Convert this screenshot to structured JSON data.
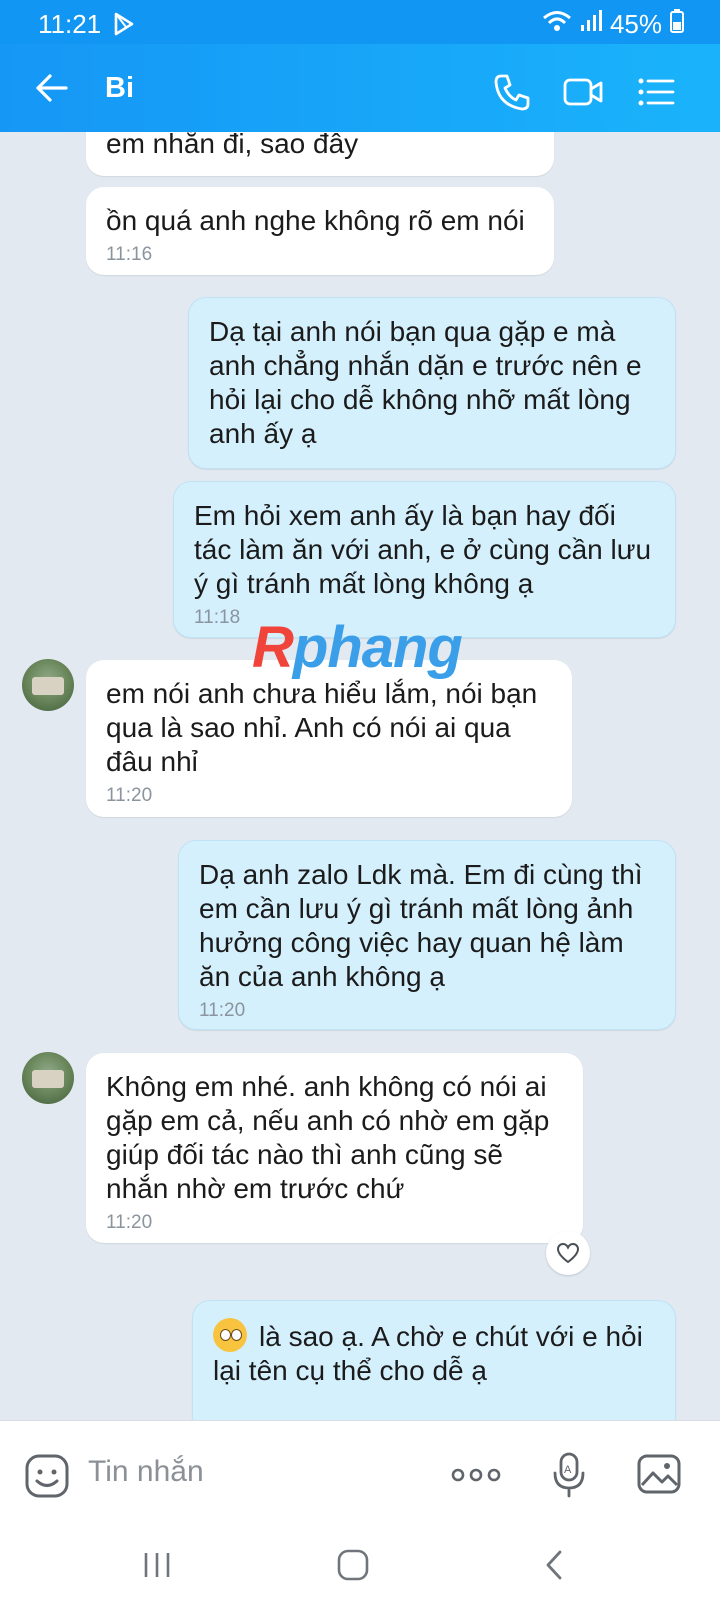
{
  "status_bar": {
    "time": "11:21",
    "battery": "45%",
    "icons": [
      "play-store-icon",
      "wifi-icon",
      "signal-icon",
      "battery-icon"
    ]
  },
  "header": {
    "contact_name": "Bi",
    "icons": [
      "back-arrow-icon",
      "phone-icon",
      "video-call-icon",
      "menu-icon"
    ]
  },
  "messages": [
    {
      "direction": "in",
      "text": "em nhắn đi, sao đây",
      "time": ""
    },
    {
      "direction": "in",
      "text": "ồn quá anh nghe không rõ em nói",
      "time": "11:16"
    },
    {
      "direction": "out",
      "text": "Dạ tại anh nói bạn qua gặp e mà\nanh chẳng nhắn dặn e trước nên e\nhỏi lại cho dễ không nhỡ mất lòng\nanh ấy ạ",
      "time": ""
    },
    {
      "direction": "out",
      "text": "Em hỏi xem anh ấy là bạn hay đối\ntác làm ăn với anh, e ở cùng cần lưu\ný gì tránh mất lòng không ạ",
      "time": "11:18"
    },
    {
      "direction": "in",
      "text": "em nói anh chưa hiểu lắm, nói bạn\nqua là sao nhỉ. Anh có nói ai qua\nđâu nhỉ",
      "time": "11:20"
    },
    {
      "direction": "out",
      "text": "Dạ anh zalo Ldk mà. Em đi cùng thì\nem cần lưu ý gì tránh mất lòng ảnh\nhưởng công việc hay quan hệ làm\năn của anh không ạ",
      "time": "11:20"
    },
    {
      "direction": "in",
      "text": "Không em nhé. anh không có nói ai\ngặp em cả, nếu anh có nhờ em gặp\ngiúp đối tác nào thì anh cũng sẽ\nnhắn nhờ em trước chứ",
      "time": "11:20"
    },
    {
      "direction": "out",
      "text": "là sao ạ. A chờ e chút với e hỏi\nlại tên cụ thể cho dễ ạ",
      "time": ""
    }
  ],
  "watermark": {
    "part1": "R",
    "part2": "phang"
  },
  "input": {
    "placeholder": "Tin nhắn",
    "icons": [
      "sticker-icon",
      "more-icon",
      "voice-icon",
      "image-icon"
    ]
  },
  "colors": {
    "header": "#1597f6",
    "outgoing_bubble": "#d5f0fd",
    "incoming_bubble": "#ffffff",
    "chat_background": "#e2e9f1"
  }
}
